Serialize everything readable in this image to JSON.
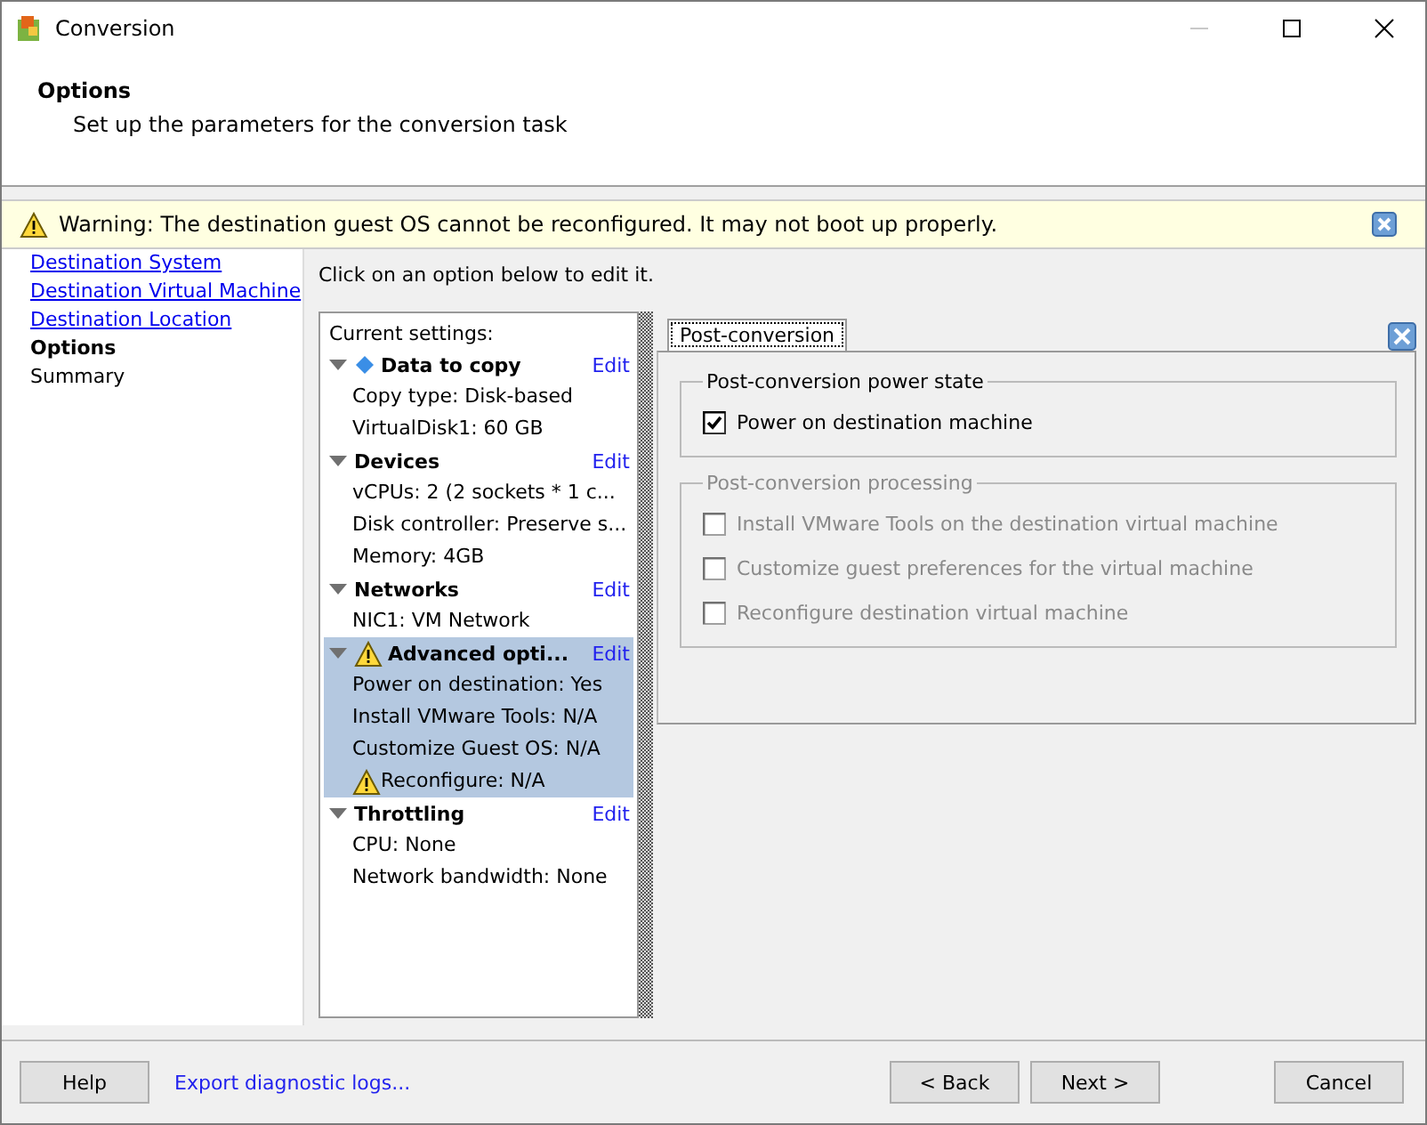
{
  "window": {
    "title": "Conversion"
  },
  "header": {
    "title": "Options",
    "subtitle": "Set up the parameters for the conversion task"
  },
  "warning": {
    "text": "Warning: The destination guest OS cannot be reconfigured. It may not boot up properly."
  },
  "nav": [
    {
      "label": "Destination System",
      "link": true,
      "selected": false
    },
    {
      "label": "Destination Virtual Machine",
      "link": true,
      "selected": false
    },
    {
      "label": "Destination Location",
      "link": true,
      "selected": false
    },
    {
      "label": "Options",
      "link": false,
      "selected": true
    },
    {
      "label": "Summary",
      "link": false,
      "selected": false
    }
  ],
  "instruction": "Click on an option below to edit it.",
  "settings": {
    "caption": "Current settings:",
    "sections": [
      {
        "title": "Data to copy",
        "kind": "diamond",
        "edit": "Edit",
        "expanded": true,
        "selected": false,
        "items": [
          {
            "text": "Copy type: Disk-based",
            "warning": false
          },
          {
            "text": "VirtualDisk1: 60 GB",
            "warning": false
          }
        ]
      },
      {
        "title": "Devices",
        "kind": "plain",
        "edit": "Edit",
        "expanded": true,
        "selected": false,
        "items": [
          {
            "text": "vCPUs: 2 (2 sockets * 1 c...",
            "warning": false
          },
          {
            "text": "Disk controller: Preserve s...",
            "warning": false
          },
          {
            "text": "Memory: 4GB",
            "warning": false
          }
        ]
      },
      {
        "title": "Networks",
        "kind": "plain",
        "edit": "Edit",
        "expanded": true,
        "selected": false,
        "items": [
          {
            "text": "NIC1: VM Network",
            "warning": false
          }
        ]
      },
      {
        "title": "Advanced opti...",
        "kind": "warning",
        "edit": "Edit",
        "expanded": true,
        "selected": true,
        "items": [
          {
            "text": "Power on destination: Yes",
            "warning": false
          },
          {
            "text": "Install VMware Tools: N/A",
            "warning": false
          },
          {
            "text": "Customize Guest OS: N/A",
            "warning": false
          },
          {
            "text": "Reconfigure: N/A",
            "warning": true
          }
        ]
      },
      {
        "title": "Throttling",
        "kind": "plain",
        "edit": "Edit",
        "expanded": true,
        "selected": false,
        "items": [
          {
            "text": "CPU: None",
            "warning": false
          },
          {
            "text": "Network bandwidth: None",
            "warning": false
          }
        ]
      }
    ]
  },
  "tabs": [
    {
      "label": "Post-conversion",
      "selected": true
    }
  ],
  "groups": [
    {
      "title": "Post-conversion power state",
      "disabled": false,
      "options": [
        {
          "label": "Power on destination machine",
          "checked": true,
          "disabled": false
        }
      ]
    },
    {
      "title": "Post-conversion processing",
      "disabled": true,
      "options": [
        {
          "label": "Install VMware Tools on the destination virtual machine",
          "checked": false,
          "disabled": true
        },
        {
          "label": "Customize guest preferences for the virtual machine",
          "checked": false,
          "disabled": true
        },
        {
          "label": "Reconfigure destination virtual machine",
          "checked": false,
          "disabled": true
        }
      ]
    }
  ],
  "footer": {
    "help": "Help",
    "export": "Export diagnostic logs...",
    "back": "< Back",
    "next": "Next >",
    "cancel": "Cancel"
  }
}
